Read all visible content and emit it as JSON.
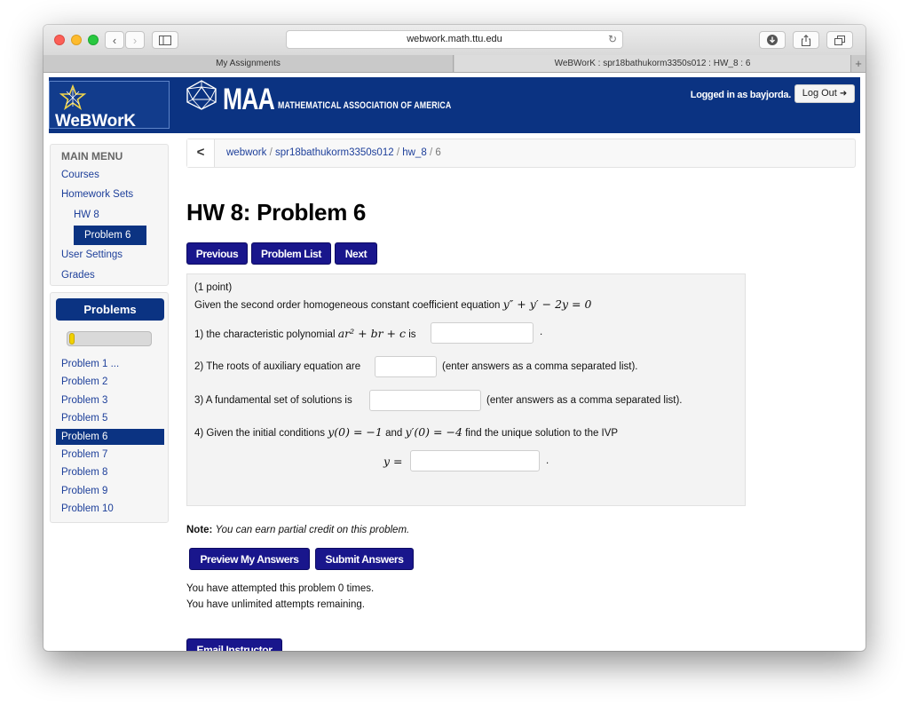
{
  "browser": {
    "url": "webwork.math.ttu.edu",
    "tabs": [
      {
        "title": "My Assignments"
      },
      {
        "title": "WeBWorK : spr18bathukorm3350s012 : HW_8 : 6"
      }
    ],
    "new_tab_label": "+"
  },
  "header": {
    "logo_text": "WeBWorK",
    "maa_logo": "MAA",
    "maa_subtitle": "MATHEMATICAL ASSOCIATION OF AMERICA",
    "logged_in_text": "Logged in as bayjorda.",
    "logout_label": "Log Out"
  },
  "menu": {
    "title": "MAIN MENU",
    "items": [
      {
        "label": "Courses"
      },
      {
        "label": "Homework Sets"
      },
      {
        "label": "HW 8"
      },
      {
        "label": "Problem 6"
      },
      {
        "label": "User Settings"
      },
      {
        "label": "Grades"
      }
    ]
  },
  "problems_panel": {
    "title": "Problems",
    "progress_fraction": 0.07,
    "items": [
      {
        "label": "Problem 1 ..."
      },
      {
        "label": "Problem 2"
      },
      {
        "label": "Problem 3"
      },
      {
        "label": "Problem 5"
      },
      {
        "label": "Problem 6"
      },
      {
        "label": "Problem 7"
      },
      {
        "label": "Problem 8"
      },
      {
        "label": "Problem 9"
      },
      {
        "label": "Problem 10"
      }
    ]
  },
  "breadcrumb": {
    "back_symbol": "<",
    "items": [
      {
        "label": "webwork"
      },
      {
        "label": "spr18bathukorm3350s012"
      },
      {
        "label": "hw_8"
      },
      {
        "label": "6"
      }
    ],
    "separator": "/"
  },
  "page": {
    "title": "HW 8: Problem 6",
    "nav_buttons": [
      {
        "label": "Previous"
      },
      {
        "label": "Problem List"
      },
      {
        "label": "Next"
      }
    ]
  },
  "problem": {
    "points": "(1 point)",
    "intro": "Given the second order homogeneous constant coefficient equation",
    "equation": "y″ + y′ − 2y = 0",
    "q1_prefix": "1) the characteristic polynomial",
    "q1_math": "ar² + br + c",
    "q1_suffix": "is",
    "q1_after": ".",
    "q2_prefix": "2) The roots of auxiliary equation are",
    "q2_hint": "(enter answers as a comma separated list).",
    "q3_prefix": "3) A fundamental set of solutions is",
    "q3_hint": "(enter answers as a comma separated list).",
    "q4_prefix": "4) Given the initial conditions",
    "q4_cond1": "y(0) = −1",
    "q4_and": "and",
    "q4_cond2": "y′(0) = −4",
    "q4_suffix": "find the unique solution to the IVP",
    "q4_answer_label": "y =",
    "q4_after": ".",
    "answers": {
      "q1": "",
      "q2": "",
      "q3": "",
      "q4": ""
    }
  },
  "note": {
    "label": "Note:",
    "text": "You can earn partial credit on this problem."
  },
  "actions": {
    "preview_label": "Preview My Answers",
    "submit_label": "Submit Answers"
  },
  "status": {
    "attempted": "You have attempted this problem 0 times.",
    "remaining": "You have unlimited attempts remaining."
  },
  "footer_button": {
    "label": "Email Instructor"
  },
  "colors": {
    "header_bg": "#0b3382",
    "button_bg": "#19168c",
    "progress_fill": "#f1d100"
  }
}
